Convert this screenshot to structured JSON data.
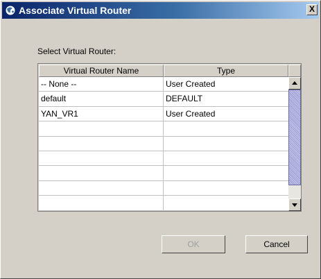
{
  "window": {
    "title": "Associate Virtual Router",
    "close_label": "X",
    "title_icon": "app-globe-icon"
  },
  "dialog": {
    "prompt": "Select Virtual Router:"
  },
  "table": {
    "columns": [
      "Virtual Router Name",
      "Type"
    ],
    "rows": [
      {
        "name": "-- None --",
        "type": "User Created"
      },
      {
        "name": "default",
        "type": "DEFAULT"
      },
      {
        "name": "YAN_VR1",
        "type": "User Created"
      },
      {
        "name": "",
        "type": ""
      },
      {
        "name": "",
        "type": ""
      },
      {
        "name": "",
        "type": ""
      },
      {
        "name": "",
        "type": ""
      },
      {
        "name": "",
        "type": ""
      },
      {
        "name": "",
        "type": ""
      }
    ]
  },
  "buttons": {
    "ok_label": "OK",
    "cancel_label": "Cancel"
  },
  "colors": {
    "title_bar_start": "#0a246a",
    "title_bar_end": "#a6caf0",
    "dialog_background": "#d4d0c8",
    "scroll_thumb": "#b8b8e0"
  }
}
